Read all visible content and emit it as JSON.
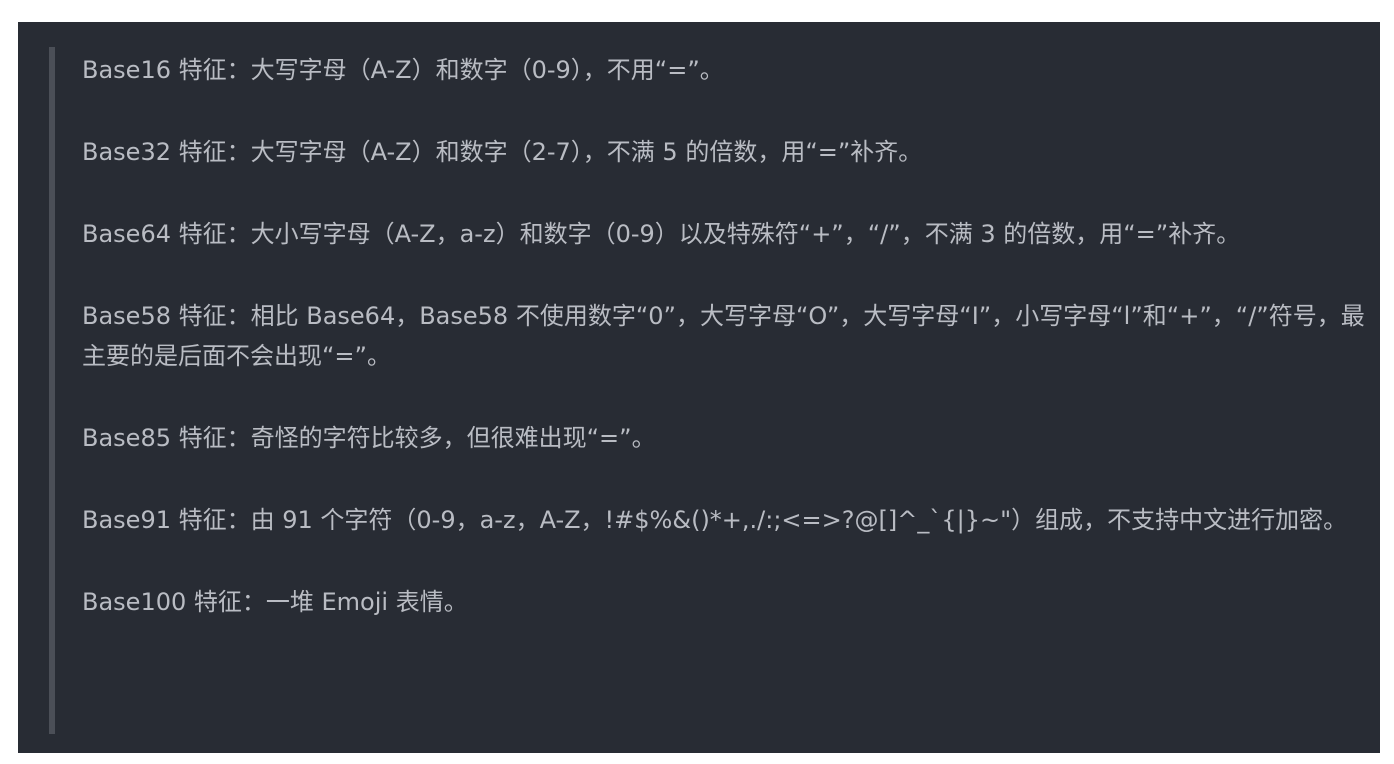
{
  "paragraphs": [
    "Base16 特征：大写字母（A-Z）和数字（0-9），不用“=”。",
    "Base32 特征：大写字母（A-Z）和数字（2-7），不满 5 的倍数，用“=”补齐。",
    "Base64 特征：大小写字母（A-Z，a-z）和数字（0-9）以及特殊符“+”，“/”，不满 3 的倍数，用“=”补齐。",
    "Base58 特征：相比 Base64，Base58 不使用数字“0”，大写字母“O”，大写字母“I”，小写字母“l”和“+”，“/”符号，最主要的是后面不会出现“=”。",
    "Base85 特征：奇怪的字符比较多，但很难出现“=”。",
    "Base91 特征：由 91 个字符（0-9，a-z，A-Z，!#$%&()*+,./:;<=>?@[]^_`{|}~\"）组成，不支持中文进行加密。",
    "Base100 特征：一堆 Emoji 表情。"
  ]
}
